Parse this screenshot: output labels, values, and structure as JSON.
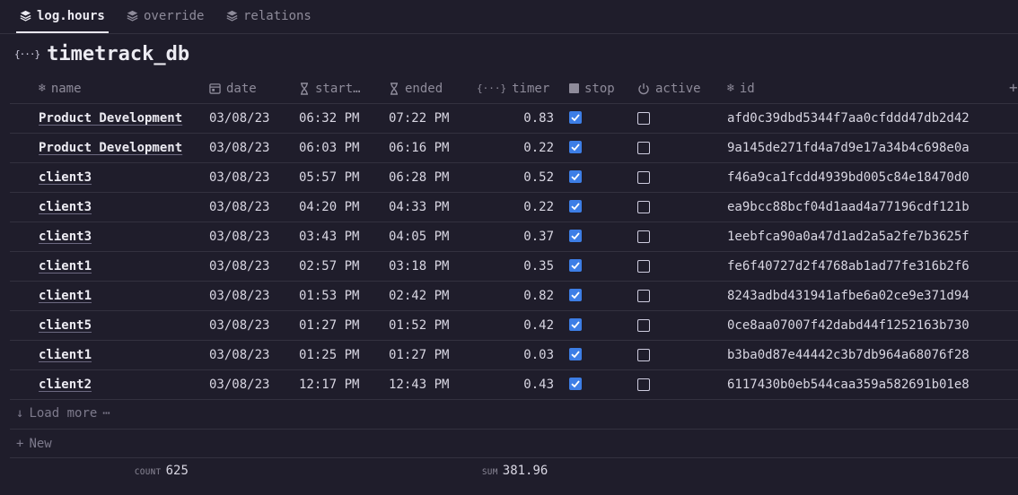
{
  "tabs": [
    {
      "label": "log.hours",
      "icon": "layers-icon",
      "active": true
    },
    {
      "label": "override",
      "icon": "layers-icon",
      "active": false
    },
    {
      "label": "relations",
      "icon": "layers-icon",
      "active": false
    }
  ],
  "title": "timetrack_db",
  "columns": {
    "name": "name",
    "date": "date",
    "start": "start…",
    "ended": "ended",
    "timer": "timer",
    "stop": "stop",
    "active": "active",
    "id": "id"
  },
  "rows": [
    {
      "name": "Product Development",
      "date": "03/08/23",
      "start": "06:32 PM",
      "ended": "07:22 PM",
      "timer": "0.83",
      "stop": true,
      "active": false,
      "id": "afd0c39dbd5344f7aa0cfddd47db2d42"
    },
    {
      "name": "Product Development",
      "date": "03/08/23",
      "start": "06:03 PM",
      "ended": "06:16 PM",
      "timer": "0.22",
      "stop": true,
      "active": false,
      "id": "9a145de271fd4a7d9e17a34b4c698e0a"
    },
    {
      "name": "client3",
      "date": "03/08/23",
      "start": "05:57 PM",
      "ended": "06:28 PM",
      "timer": "0.52",
      "stop": true,
      "active": false,
      "id": "f46a9ca1fcdd4939bd005c84e18470d0"
    },
    {
      "name": "client3",
      "date": "03/08/23",
      "start": "04:20 PM",
      "ended": "04:33 PM",
      "timer": "0.22",
      "stop": true,
      "active": false,
      "id": "ea9bcc88bcf04d1aad4a77196cdf121b"
    },
    {
      "name": "client3",
      "date": "03/08/23",
      "start": "03:43 PM",
      "ended": "04:05 PM",
      "timer": "0.37",
      "stop": true,
      "active": false,
      "id": "1eebfca90a0a47d1ad2a5a2fe7b3625f"
    },
    {
      "name": "client1",
      "date": "03/08/23",
      "start": "02:57 PM",
      "ended": "03:18 PM",
      "timer": "0.35",
      "stop": true,
      "active": false,
      "id": "fe6f40727d2f4768ab1ad77fe316b2f6"
    },
    {
      "name": "client1",
      "date": "03/08/23",
      "start": "01:53 PM",
      "ended": "02:42 PM",
      "timer": "0.82",
      "stop": true,
      "active": false,
      "id": "8243adbd431941afbe6a02ce9e371d94"
    },
    {
      "name": "client5",
      "date": "03/08/23",
      "start": "01:27 PM",
      "ended": "01:52 PM",
      "timer": "0.42",
      "stop": true,
      "active": false,
      "id": "0ce8aa07007f42dabd44f1252163b730"
    },
    {
      "name": "client1",
      "date": "03/08/23",
      "start": "01:25 PM",
      "ended": "01:27 PM",
      "timer": "0.03",
      "stop": true,
      "active": false,
      "id": "b3ba0d87e44442c3b7db964a68076f28"
    },
    {
      "name": "client2",
      "date": "03/08/23",
      "start": "12:17 PM",
      "ended": "12:43 PM",
      "timer": "0.43",
      "stop": true,
      "active": false,
      "id": "6117430b0eb544caa359a582691b01e8"
    }
  ],
  "load_more": "Load more",
  "new_label": "New",
  "footer": {
    "count_label": "COUNT",
    "count_value": "625",
    "sum_label": "SUM",
    "sum_value": "381.96"
  },
  "colors": {
    "background": "#1f1d2b",
    "checkbox_checked": "#3d7ee6",
    "border": "#33313f"
  }
}
